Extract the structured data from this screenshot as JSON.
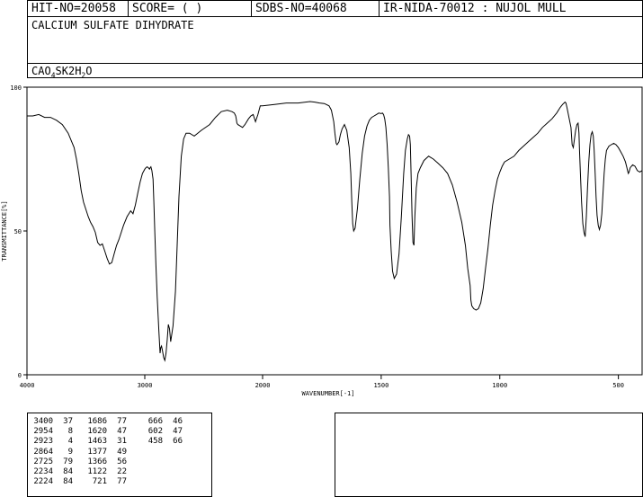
{
  "header": {
    "hit_no": "HIT-NO=20058",
    "score": "SCORE=  (   )",
    "sdbs_no": "SDBS-NO=40068",
    "ir_info": "IR-NIDA-70012 : NUJOL MULL"
  },
  "compound": {
    "name": "CALCIUM SULFATE DIHYDRATE",
    "formula_parts": [
      {
        "t": "CAO",
        "sub": false
      },
      {
        "t": "4",
        "sub": true
      },
      {
        "t": "SK2H",
        "sub": false
      },
      {
        "t": "2",
        "sub": true
      },
      {
        "t": "O",
        "sub": false
      }
    ]
  },
  "chart_data": {
    "type": "line",
    "title": "",
    "xlabel": "WAVENUMBER[-1]",
    "ylabel": "TRANSMITTANCE[%]",
    "xlim": [
      4000,
      400
    ],
    "ylim": [
      0,
      100
    ],
    "x_ticks": [
      4000,
      3000,
      2000,
      1500,
      1000,
      500
    ],
    "y_ticks": [
      0,
      50,
      100
    ],
    "grid": false,
    "legend": "none",
    "series": [
      {
        "x": [
          4000,
          3950,
          3900,
          3850,
          3800,
          3750,
          3700,
          3650,
          3600,
          3580,
          3560,
          3540,
          3520,
          3500,
          3480,
          3460,
          3440,
          3420,
          3400,
          3380,
          3360,
          3340,
          3320,
          3300,
          3280,
          3260,
          3240,
          3220,
          3200,
          3180,
          3150,
          3120,
          3100,
          3080,
          3060,
          3040,
          3020,
          3000,
          2990,
          2980,
          2970,
          2960,
          2954,
          2948,
          2940,
          2930,
          2923,
          2915,
          2905,
          2895,
          2880,
          2870,
          2864,
          2858,
          2850,
          2840,
          2830,
          2820,
          2810,
          2800,
          2790,
          2780,
          2760,
          2740,
          2725,
          2710,
          2690,
          2670,
          2650,
          2620,
          2580,
          2520,
          2450,
          2400,
          2350,
          2300,
          2260,
          2240,
          2234,
          2228,
          2224,
          2218,
          2210,
          2190,
          2170,
          2150,
          2120,
          2100,
          2080,
          2060,
          2040,
          2020,
          2000,
          1950,
          1900,
          1850,
          1800,
          1780,
          1760,
          1740,
          1720,
          1710,
          1700,
          1695,
          1690,
          1686,
          1682,
          1678,
          1672,
          1665,
          1655,
          1645,
          1635,
          1628,
          1624,
          1620,
          1616,
          1610,
          1600,
          1590,
          1580,
          1570,
          1560,
          1550,
          1540,
          1530,
          1520,
          1510,
          1500,
          1495,
          1490,
          1485,
          1480,
          1475,
          1470,
          1465,
          1463,
          1458,
          1452,
          1445,
          1435,
          1425,
          1415,
          1405,
          1398,
          1390,
          1385,
          1380,
          1377,
          1374,
          1370,
          1366,
          1362,
          1358,
          1352,
          1345,
          1335,
          1320,
          1300,
          1280,
          1260,
          1240,
          1220,
          1200,
          1180,
          1160,
          1145,
          1135,
          1125,
          1122,
          1118,
          1110,
          1100,
          1090,
          1080,
          1070,
          1060,
          1050,
          1040,
          1030,
          1020,
          1010,
          1000,
          990,
          980,
          960,
          940,
          920,
          900,
          880,
          860,
          840,
          820,
          800,
          780,
          760,
          745,
          735,
          725,
          721,
          717,
          712,
          705,
          700,
          695,
          690,
          685,
          680,
          675,
          670,
          668,
          666,
          664,
          660,
          655,
          650,
          645,
          640,
          635,
          630,
          625,
          620,
          615,
          610,
          606,
          602,
          598,
          594,
          590,
          585,
          580,
          575,
          570,
          565,
          560,
          555,
          550,
          540,
          530,
          520,
          510,
          500,
          490,
          480,
          470,
          464,
          460,
          458,
          455,
          450,
          440,
          430,
          420,
          410,
          400
        ],
        "y": [
          90,
          90,
          90.5,
          89.5,
          89.5,
          88.5,
          87,
          84,
          79,
          75,
          70,
          64,
          60,
          57.5,
          55,
          53,
          51.5,
          49.5,
          46,
          45,
          45.5,
          43,
          40.5,
          38.5,
          39,
          42,
          45,
          47,
          49.5,
          52,
          55,
          57,
          56,
          59,
          63,
          67,
          70,
          71.5,
          72,
          72.3,
          72,
          71.5,
          72,
          72.3,
          71,
          68,
          60,
          50,
          38,
          27,
          15,
          7.5,
          9.5,
          10,
          8.5,
          6,
          5,
          7.5,
          12,
          17.5,
          16,
          11.5,
          17,
          29,
          45,
          62,
          76,
          82,
          84,
          84,
          83,
          85,
          87,
          89.5,
          91.5,
          92,
          91.5,
          91,
          90.5,
          90,
          89,
          87.5,
          87,
          86.5,
          86,
          87,
          89,
          90,
          90.5,
          88,
          90.5,
          93.5,
          93.5,
          94,
          94.5,
          94.5,
          95,
          94.8,
          94.5,
          94.3,
          93.5,
          92,
          88,
          84,
          80.5,
          80,
          80.5,
          81,
          83.5,
          85.5,
          87,
          85,
          79,
          70,
          60,
          52.5,
          50,
          51,
          58,
          68,
          77,
          83,
          86.5,
          88.5,
          89.5,
          90,
          90.5,
          91,
          90.8,
          91,
          90.5,
          89,
          86,
          80,
          72,
          62,
          52,
          43,
          36,
          33.5,
          35,
          42,
          55,
          70,
          78,
          82,
          83.5,
          83,
          80,
          70,
          55,
          46,
          45,
          55,
          65,
          70,
          72,
          74.5,
          76,
          75,
          73.5,
          72,
          70,
          66,
          60,
          53,
          45,
          37,
          31,
          26,
          24,
          23,
          22.5,
          23,
          25,
          30,
          37,
          44,
          52,
          59,
          64,
          68,
          70.5,
          72.5,
          74,
          75,
          76,
          78,
          79.5,
          81,
          82.5,
          84,
          86,
          87.5,
          89,
          91,
          93,
          94,
          94.8,
          94.5,
          93,
          91,
          88,
          86,
          80,
          79,
          82,
          85,
          87,
          87.5,
          86,
          84,
          78,
          70,
          60,
          52.5,
          49.5,
          48,
          55,
          65,
          74,
          80,
          83.5,
          84.5,
          83,
          78,
          70,
          62,
          55.5,
          52,
          50.5,
          52,
          56,
          63,
          70,
          75,
          78,
          79.5,
          80,
          80.5,
          80,
          79,
          77.5,
          76,
          74,
          72,
          70.5,
          70,
          70.5,
          72,
          73,
          72.5,
          71,
          70.5,
          71
        ]
      }
    ]
  },
  "peaks": {
    "columns": [
      [
        [
          "3400",
          "37"
        ],
        [
          "2954",
          "8"
        ],
        [
          "2923",
          "4"
        ],
        [
          "2864",
          "9"
        ],
        [
          "2725",
          "79"
        ],
        [
          "2234",
          "84"
        ],
        [
          "2224",
          "84"
        ]
      ],
      [
        [
          "1686",
          "77"
        ],
        [
          "1620",
          "47"
        ],
        [
          "1463",
          "31"
        ],
        [
          "1377",
          "49"
        ],
        [
          "1366",
          "56"
        ],
        [
          "1122",
          "22"
        ],
        [
          "721",
          "77"
        ]
      ],
      [
        [
          "666",
          "46"
        ],
        [
          "602",
          "47"
        ],
        [
          "458",
          "66"
        ]
      ]
    ]
  }
}
